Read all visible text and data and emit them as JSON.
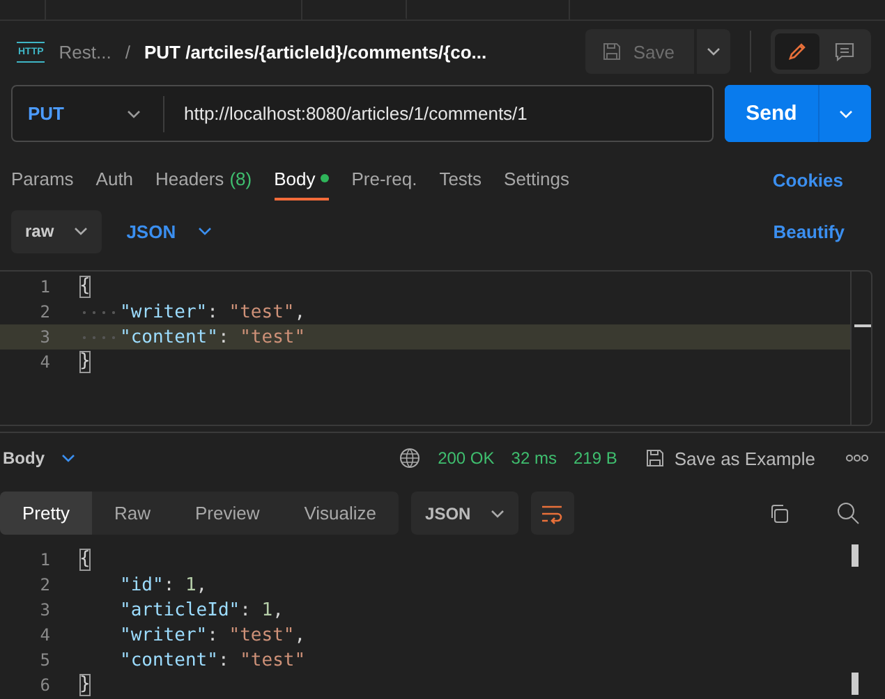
{
  "breadcrumb": {
    "icon_label": "HTTP",
    "parent": "Rest...",
    "separator": "/",
    "current": "PUT /artciles/{articleId}/comments/{co..."
  },
  "save_button": {
    "label": "Save",
    "disabled": true
  },
  "mode_toggle": [
    {
      "kind": "edit",
      "selected": true
    },
    {
      "kind": "comments",
      "selected": false
    }
  ],
  "request": {
    "method": "PUT",
    "url": "http://localhost:8080/articles/1/comments/1",
    "send": "Send"
  },
  "request_tabs": [
    {
      "label": "Params",
      "selected": false
    },
    {
      "label": "Auth",
      "selected": false
    },
    {
      "label": "Headers",
      "count": "(8)",
      "selected": false
    },
    {
      "label": "Body",
      "selected": true,
      "has_content": true
    },
    {
      "label": "Pre-req.",
      "selected": false
    },
    {
      "label": "Tests",
      "selected": false
    },
    {
      "label": "Settings",
      "selected": false
    }
  ],
  "cookies": "Cookies",
  "body_mode": "raw",
  "body_format": "JSON",
  "beautify": "Beautify",
  "request_body": {
    "show_whitespace": true,
    "lines": [
      {
        "number": "1",
        "highlighted": false,
        "indented": false,
        "tokens": [
          {
            "kind": "brace",
            "text": "{"
          }
        ]
      },
      {
        "number": "2",
        "highlighted": false,
        "indented": true,
        "tokens": [
          {
            "kind": "key",
            "text": "\"writer\""
          },
          {
            "kind": "punct",
            "text": ": "
          },
          {
            "kind": "string",
            "text": "\"test\""
          },
          {
            "kind": "punct",
            "text": ","
          }
        ]
      },
      {
        "number": "3",
        "highlighted": true,
        "indented": true,
        "tokens": [
          {
            "kind": "key",
            "text": "\"content\""
          },
          {
            "kind": "punct",
            "text": ": "
          },
          {
            "kind": "string",
            "text": "\"test\""
          }
        ]
      },
      {
        "number": "4",
        "highlighted": false,
        "indented": false,
        "tokens": [
          {
            "kind": "brace",
            "text": "}"
          }
        ]
      }
    ]
  },
  "response": {
    "label": "Body",
    "status": "200 OK",
    "time": "32 ms",
    "size": "219 B",
    "save_example": "Save as Example",
    "view_tabs": [
      {
        "label": "Pretty",
        "selected": true
      },
      {
        "label": "Raw",
        "selected": false
      },
      {
        "label": "Preview",
        "selected": false
      },
      {
        "label": "Visualize",
        "selected": false
      }
    ],
    "format": "JSON",
    "wrap": true,
    "show_whitespace": false,
    "lines": [
      {
        "number": "1",
        "highlighted": false,
        "indented": false,
        "tokens": [
          {
            "kind": "brace",
            "text": "{"
          }
        ]
      },
      {
        "number": "2",
        "highlighted": false,
        "indented": true,
        "tokens": [
          {
            "kind": "key",
            "text": "\"id\""
          },
          {
            "kind": "punct",
            "text": ": "
          },
          {
            "kind": "number",
            "text": "1"
          },
          {
            "kind": "punct",
            "text": ","
          }
        ]
      },
      {
        "number": "3",
        "highlighted": false,
        "indented": true,
        "tokens": [
          {
            "kind": "key",
            "text": "\"articleId\""
          },
          {
            "kind": "punct",
            "text": ": "
          },
          {
            "kind": "number",
            "text": "1"
          },
          {
            "kind": "punct",
            "text": ","
          }
        ]
      },
      {
        "number": "4",
        "highlighted": false,
        "indented": true,
        "tokens": [
          {
            "kind": "key",
            "text": "\"writer\""
          },
          {
            "kind": "punct",
            "text": ": "
          },
          {
            "kind": "string",
            "text": "\"test\""
          },
          {
            "kind": "punct",
            "text": ","
          }
        ]
      },
      {
        "number": "5",
        "highlighted": false,
        "indented": true,
        "tokens": [
          {
            "kind": "key",
            "text": "\"content\""
          },
          {
            "kind": "punct",
            "text": ": "
          },
          {
            "kind": "string",
            "text": "\"test\""
          }
        ]
      },
      {
        "number": "6",
        "highlighted": false,
        "indented": false,
        "tokens": [
          {
            "kind": "brace",
            "text": "}"
          }
        ]
      }
    ]
  }
}
